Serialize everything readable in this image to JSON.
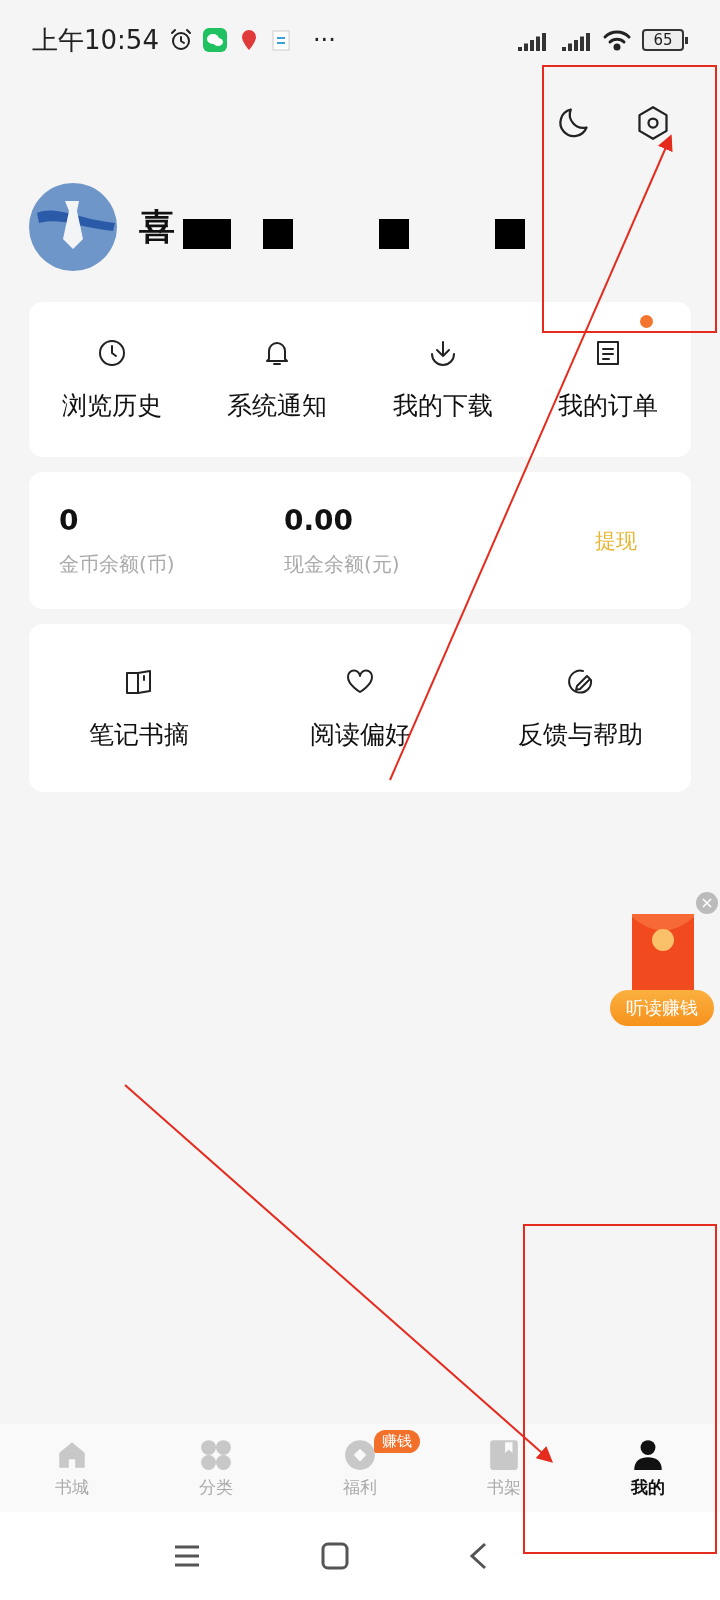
{
  "status_bar": {
    "time": "上午10:54",
    "more": "···",
    "battery": "65"
  },
  "profile": {
    "name": "喜"
  },
  "shortcuts": [
    {
      "label": "浏览历史",
      "dot": false
    },
    {
      "label": "系统通知",
      "dot": false
    },
    {
      "label": "我的下载",
      "dot": false
    },
    {
      "label": "我的订单",
      "dot": true
    }
  ],
  "balances": [
    {
      "value": "0",
      "label": "金币余额(币)"
    },
    {
      "value": "0.00",
      "label": "现金余额(元)"
    }
  ],
  "withdraw": "提现",
  "services": [
    {
      "label": "笔记书摘"
    },
    {
      "label": "阅读偏好"
    },
    {
      "label": "反馈与帮助"
    }
  ],
  "floating_promo": {
    "label": "听读赚钱"
  },
  "tabs": [
    {
      "label": "书城",
      "selected": false
    },
    {
      "label": "分类",
      "selected": false
    },
    {
      "label": "福利",
      "selected": false,
      "badge": "赚钱"
    },
    {
      "label": "书架",
      "selected": false
    },
    {
      "label": "我的",
      "selected": true
    }
  ]
}
